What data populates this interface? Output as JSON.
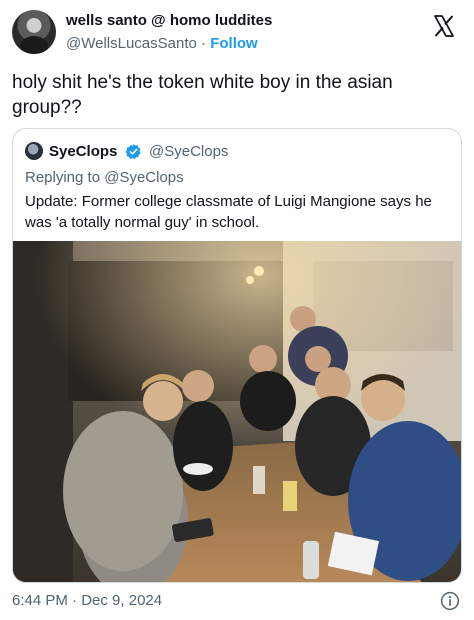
{
  "author": {
    "display_name": "wells santo @ homo luddites",
    "handle": "@WellsLucasSanto",
    "separator": "·",
    "follow_label": "Follow"
  },
  "tweet": {
    "text": "holy shit he's the token white boy in the asian group??"
  },
  "quoted": {
    "display_name": "SyeClops",
    "handle": "@SyeClops",
    "replying_prefix": "Replying to ",
    "replying_to": "@SyeClops",
    "text": "Update: Former college classmate of Luigi Mangione says he was 'a totally normal guy' in school."
  },
  "meta": {
    "time": "6:44 PM",
    "separator": "·",
    "date": "Dec 9, 2024"
  },
  "icons": {
    "brand": "x-logo-icon",
    "verified": "verified-badge-icon",
    "info": "info-icon"
  },
  "colors": {
    "link": "#1d9bf0",
    "muted": "#536471",
    "text": "#0f1419",
    "border": "#cfd9de"
  }
}
